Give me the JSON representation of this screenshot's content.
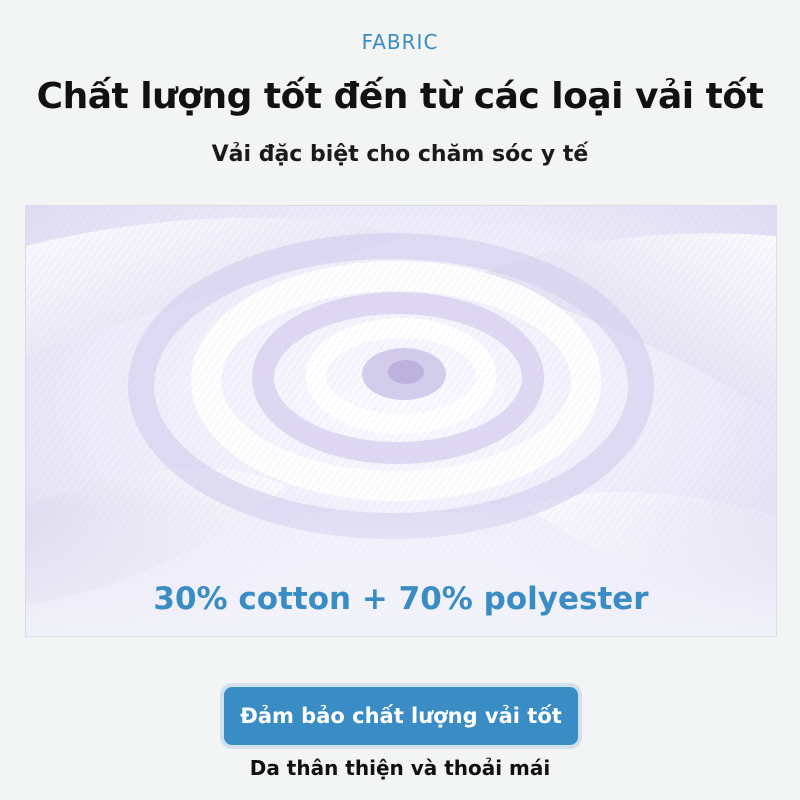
{
  "header": {
    "eyebrow": "FABRIC",
    "title": "Chất lượng tốt đến từ các loại vải tốt",
    "subtitle": "Vải đặc biệt cho chăm sóc y tế"
  },
  "photo": {
    "subject": "fabric-swirl-image",
    "composition_label": "30% cotton + 70% polyester"
  },
  "badge": {
    "label": "Đảm bảo chất lượng vải tốt"
  },
  "footer": {
    "text": "Da thân thiện và thoải mái"
  },
  "colors": {
    "accent": "#3a8cc4",
    "background": "#f3f4f4",
    "heading": "#111111"
  }
}
